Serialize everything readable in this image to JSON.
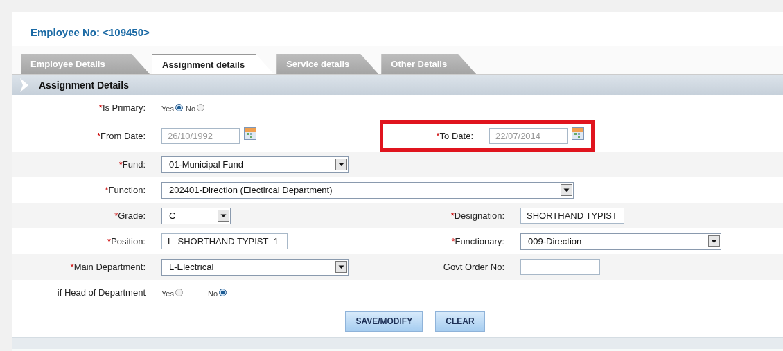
{
  "header": {
    "title": "Employee No: <109450>"
  },
  "tabs": [
    {
      "label": "Employee Details",
      "selected": false
    },
    {
      "label": "Assignment details",
      "selected": true
    },
    {
      "label": "Service details",
      "selected": false
    },
    {
      "label": "Other Details",
      "selected": false
    }
  ],
  "section": {
    "title": "Assignment Details"
  },
  "rows": [
    {
      "left": {
        "label": "Is Primary:",
        "mark": "*",
        "kind": "radio",
        "options": [
          {
            "label": "Yes",
            "selected": true
          },
          {
            "label": "No",
            "selected": false
          }
        ]
      },
      "right": null
    },
    {
      "left": {
        "label": "From Date:",
        "mark": "*",
        "kind": "date",
        "value": "26/10/1992"
      },
      "right": {
        "label": "To Date:",
        "mark": "*",
        "kind": "date",
        "value": "22/07/2014",
        "highlighted": true
      }
    },
    {
      "left": {
        "label": "Fund:",
        "mark": "*",
        "kind": "select",
        "value": "01-Municipal Fund"
      },
      "right": null
    },
    {
      "left": {
        "label": "Function:",
        "mark": "*",
        "kind": "select",
        "value": "202401-Direction (Electircal Department)"
      },
      "right": null
    },
    {
      "left": {
        "label": "Grade:",
        "mark": "*",
        "kind": "select",
        "value": "C"
      },
      "right": {
        "label": "Designation:",
        "mark": "*",
        "kind": "text",
        "value": "SHORTHAND TYPIST"
      }
    },
    {
      "left": {
        "label": "Position:",
        "mark": "*",
        "kind": "text",
        "value": "L_SHORTHAND TYPIST_1"
      },
      "right": {
        "label": "Functionary:",
        "mark": "*",
        "kind": "select",
        "value": "009-Direction"
      }
    },
    {
      "left": {
        "label": "Main Department:",
        "mark": "*",
        "kind": "select",
        "value": "L-Electrical"
      },
      "right": {
        "label": "Govt Order No:",
        "kind": "text"
      }
    },
    {
      "left": {
        "label": "if Head of Department",
        "kind": "radio",
        "spaced": true,
        "options": [
          {
            "label": "Yes",
            "selected": false
          },
          {
            "label": "No",
            "selected": true
          }
        ]
      },
      "right": null
    }
  ],
  "buttons": [
    "SAVE/MODIFY",
    "CLEAR"
  ]
}
